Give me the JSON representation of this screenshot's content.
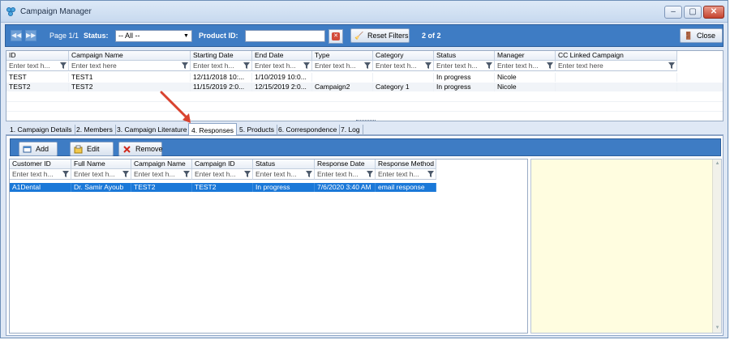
{
  "window": {
    "title": "Campaign Manager",
    "controls": {
      "minimize": "–",
      "maximize": "▢",
      "close": "✕"
    }
  },
  "toolbar": {
    "page_label": "Page 1/1",
    "status_label": "Status:",
    "status_value": "-- All --",
    "product_id_label": "Product ID:",
    "product_id_value": "",
    "reset_label": "Reset Filters",
    "count_label": "2 of 2",
    "close_label": "Close",
    "accent_color": "#3e7cc4"
  },
  "campaign_grid": {
    "filter_placeholder": "Enter text h...",
    "filter_placeholder_full": "Enter text here",
    "columns": [
      "ID",
      "Campaign Name",
      "Starting Date",
      "End Date",
      "Type",
      "Category",
      "Status",
      "Manager",
      "CC Linked Campaign"
    ],
    "rows": [
      [
        "TEST",
        "TEST1",
        "12/11/2018 10:...",
        "1/10/2019 10:0...",
        "",
        "",
        "In progress",
        "Nicole",
        ""
      ],
      [
        "TEST2",
        "TEST2",
        "11/15/2019 2:0...",
        "12/15/2019 2:0...",
        "Campaign2",
        "Category 1",
        "In progress",
        "Nicole",
        ""
      ]
    ]
  },
  "tabs": [
    {
      "label": "1. Campaign Details",
      "active": false
    },
    {
      "label": "2. Members",
      "active": false
    },
    {
      "label": "3. Campaign Literature",
      "active": false
    },
    {
      "label": "4. Responses",
      "active": true
    },
    {
      "label": "5. Products",
      "active": false
    },
    {
      "label": "6. Correspondence",
      "active": false
    },
    {
      "label": "7. Log",
      "active": false
    }
  ],
  "responses": {
    "add_label": "Add",
    "edit_label": "Edit",
    "remove_label": "Remove",
    "filter_placeholder": "Enter text h...",
    "columns": [
      "Customer ID",
      "Full Name",
      "Campaign Name",
      "Campaign ID",
      "Status",
      "Response Date",
      "Response Method"
    ],
    "rows": [
      [
        "A1Dental",
        "Dr. Samir Ayoub",
        "TEST2",
        "TEST2",
        "In progress",
        "7/6/2020 3:40 AM",
        "email response"
      ]
    ],
    "selected_color": "#1a78d8"
  },
  "notes": {
    "background": "#fffde0"
  }
}
